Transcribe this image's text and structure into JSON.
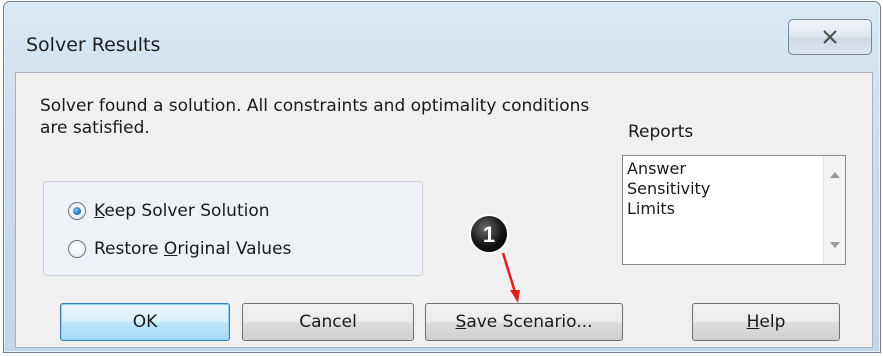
{
  "window": {
    "title": "Solver Results",
    "close_icon": "close-x-icon"
  },
  "message": "Solver found a solution.  All constraints and optimality conditions are satisfied.",
  "reports": {
    "label": "Reports",
    "items": [
      "Answer",
      "Sensitivity",
      "Limits"
    ]
  },
  "options": {
    "keep": {
      "accel": "K",
      "rest": "eep Solver Solution",
      "checked": true
    },
    "restore": {
      "pre": "Restore ",
      "accel": "O",
      "rest": "riginal Values",
      "checked": false
    }
  },
  "buttons": {
    "ok": "OK",
    "cancel": "Cancel",
    "save": {
      "accel": "S",
      "rest": "ave Scenario..."
    },
    "help": {
      "accel": "H",
      "rest": "elp"
    }
  },
  "annotation": {
    "callout_number": "1",
    "arrow_color": "#e02020"
  }
}
